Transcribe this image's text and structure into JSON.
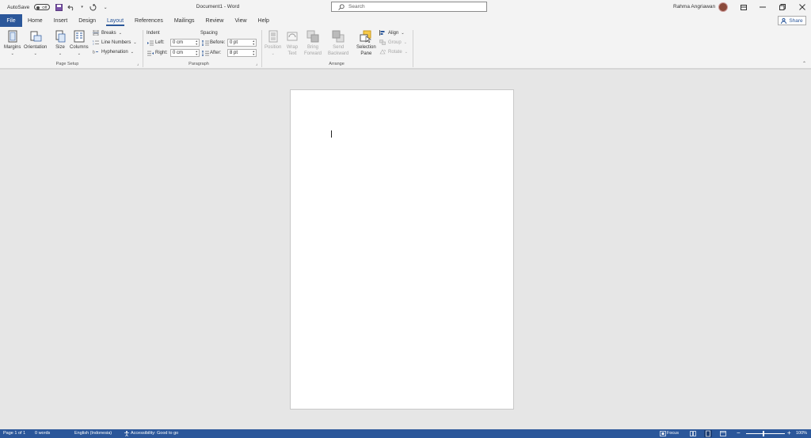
{
  "titlebar": {
    "autosave_label": "AutoSave",
    "autosave_state": "Off",
    "doc_title": "Document1  -  Word",
    "search_placeholder": "Search",
    "user_name": "Rahma Angriawan"
  },
  "tabs": [
    "File",
    "Home",
    "Insert",
    "Design",
    "Layout",
    "References",
    "Mailings",
    "Review",
    "View",
    "Help"
  ],
  "active_tab": "Layout",
  "share_label": "Share",
  "page_setup": {
    "margins": "Margins",
    "orientation": "Orientation",
    "size": "Size",
    "columns": "Columns",
    "breaks": "Breaks",
    "line_numbers": "Line Numbers",
    "hyphenation": "Hyphenation",
    "group_label": "Page Setup"
  },
  "paragraph": {
    "indent_label": "Indent",
    "spacing_label": "Spacing",
    "left_label": "Left:",
    "left_value": "0 cm",
    "right_label": "Right:",
    "right_value": "0 cm",
    "before_label": "Before:",
    "before_value": "0 pt",
    "after_label": "After:",
    "after_value": "8 pt",
    "group_label": "Paragraph"
  },
  "arrange": {
    "position": "Position",
    "wrap_1": "Wrap",
    "wrap_2": "Text",
    "bring_1": "Bring",
    "bring_2": "Forward",
    "send_1": "Send",
    "send_2": "Backward",
    "selection_1": "Selection",
    "selection_2": "Pane",
    "align": "Align",
    "group": "Group",
    "rotate": "Rotate",
    "group_label": "Arrange"
  },
  "status": {
    "page": "Page 1 of 1",
    "words": "0 words",
    "language": "English (Indonesia)",
    "accessibility": "Accessibility: Good to go",
    "focus": "Focus",
    "zoom": "100%"
  },
  "colors": {
    "accent": "#2b579a",
    "ribbon_bg": "#f3f3f3",
    "canvas_bg": "#e6e6e6"
  }
}
